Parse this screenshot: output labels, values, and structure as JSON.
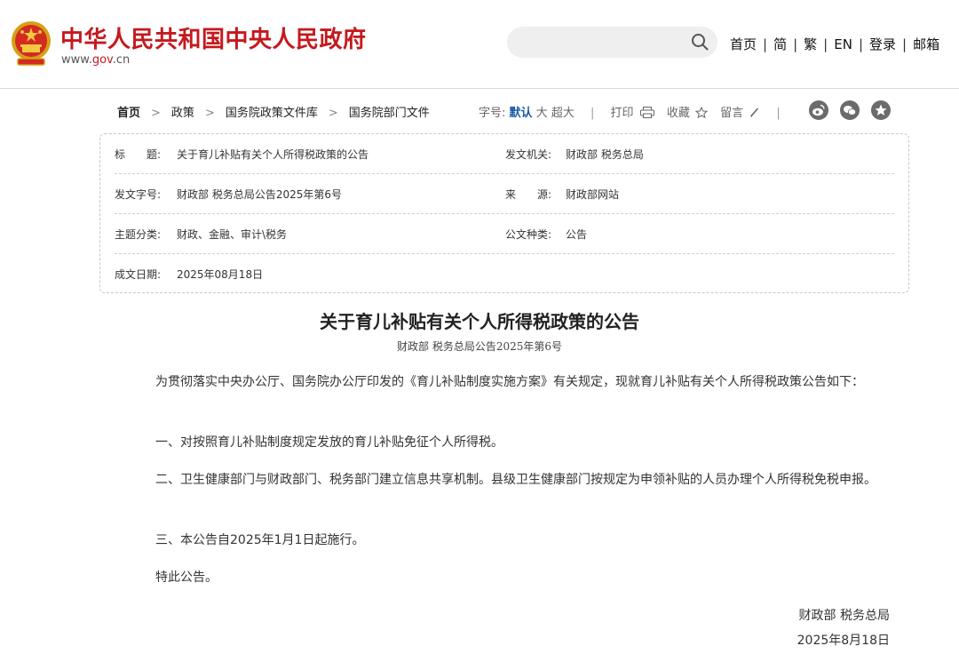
{
  "header": {
    "site_title": "中华人民共和国中央人民政府",
    "site_url_prefix": "www.",
    "site_url_domain": "gov",
    "site_url_suffix": ".cn",
    "search_placeholder": "",
    "nav": [
      "首页",
      "简",
      "繁",
      "EN",
      "登录",
      "邮箱"
    ]
  },
  "breadcrumb": [
    "首页",
    "政策",
    "国务院政策文件库",
    "国务院部门文件"
  ],
  "toolbar": {
    "font_label": "字号:",
    "font_default": "默认",
    "font_large": "大",
    "font_xlarge": "超大",
    "print": "打印",
    "favorite": "收藏",
    "comment": "留言"
  },
  "info": {
    "title_label": "标　　题:",
    "title_value": "关于育儿补贴有关个人所得税政策的公告",
    "issuer_label": "发文机关:",
    "issuer_value": "财政部 税务总局",
    "docno_label": "发文字号:",
    "docno_value": "财政部 税务总局公告2025年第6号",
    "source_label": "来　　源:",
    "source_value": "财政部网站",
    "topic_label": "主题分类:",
    "topic_value": "财政、金融、审计\\税务",
    "type_label": "公文种类:",
    "type_value": "公告",
    "date_label": "成文日期:",
    "date_value": "2025年08月18日"
  },
  "article": {
    "title": "关于育儿补贴有关个人所得税政策的公告",
    "subtitle": "财政部 税务总局公告2025年第6号",
    "paragraphs": [
      "为贯彻落实中央办公厅、国务院办公厅印发的《育儿补贴制度实施方案》有关规定，现就育儿补贴有关个人所得税政策公告如下：",
      "一、对按照育儿补贴制度规定发放的育儿补贴免征个人所得税。",
      "二、卫生健康部门与财政部门、税务部门建立信息共享机制。县级卫生健康部门按规定为申领补贴的人员办理个人所得税免税申报。",
      "三、本公告自2025年1月1日起施行。",
      "特此公告。"
    ],
    "signature_org": "财政部 税务总局",
    "signature_date": "2025年8月18日"
  },
  "colors": {
    "brand_red": "#c4191e",
    "link_blue": "#1a5aa6"
  }
}
